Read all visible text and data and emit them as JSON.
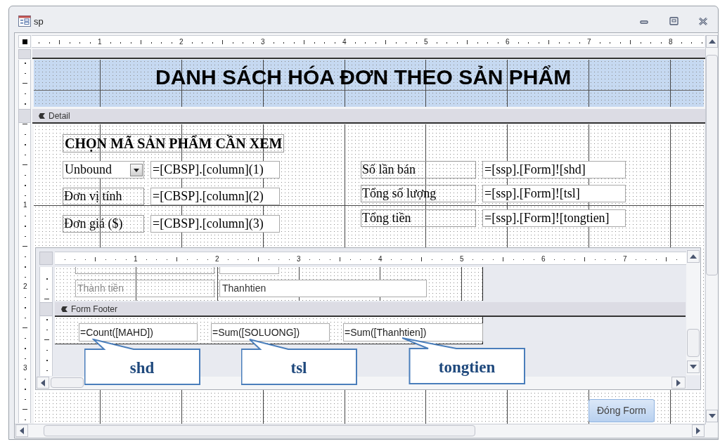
{
  "window": {
    "title": "sp"
  },
  "ruler": {
    "labels": [
      "1",
      "2",
      "3",
      "4",
      "5",
      "6",
      "7",
      "8"
    ]
  },
  "vertical_ruler": {
    "labels": [
      "1",
      "2",
      "3"
    ]
  },
  "form_header": {
    "title": "DANH SÁCH HÓA ĐƠN THEO SẢN PHẨM"
  },
  "detail": {
    "section_label": "Detail",
    "heading": "CHỌN MÃ SẢN PHẨM CẦN XEM",
    "left_controls": [
      {
        "kind": "combo",
        "label": "Unbound",
        "value": "=[CBSP].[column](1)"
      },
      {
        "kind": "label",
        "label": "Đơn vị tính",
        "value": "=[CBSP].[column](2)"
      },
      {
        "kind": "label",
        "label": "Đơn giá ($)",
        "value": "=[CBSP].[column](3)"
      }
    ],
    "right_controls": [
      {
        "label": "Số lần bán",
        "value": "=[ssp].[Form]![shd]"
      },
      {
        "label": "Tổng số lượng",
        "value": "=[ssp].[Form]![tsl]"
      },
      {
        "label": "Tổng tiền",
        "value": "=[ssp].[Form]![tongtien]"
      }
    ],
    "close_button": "Đóng Form"
  },
  "subform": {
    "ruler_labels": [
      "1",
      "2",
      "3",
      "4",
      "5",
      "6",
      "7"
    ],
    "detail_controls": [
      {
        "label": "Thành tiền",
        "value": "Thanhtien"
      }
    ],
    "footer_label": "Form Footer",
    "footer_fields": [
      "=Count([MAHD])",
      "=Sum([SOLUONG])",
      "=Sum([Thanhtien])"
    ]
  },
  "callouts": [
    "shd",
    "tsl",
    "tongtien"
  ]
}
